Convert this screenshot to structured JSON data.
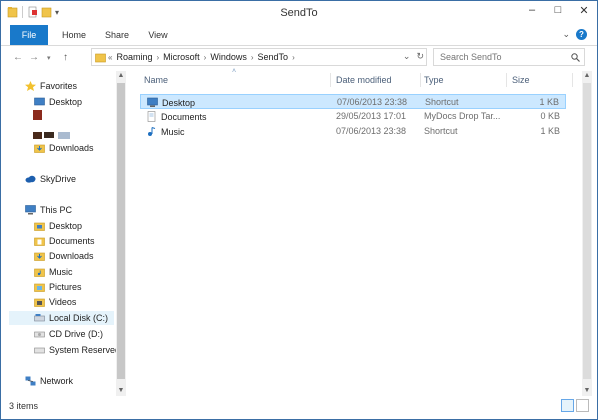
{
  "window": {
    "title": "SendTo"
  },
  "ribbon": {
    "tabs": [
      "File",
      "Home",
      "Share",
      "View"
    ],
    "expand_icon": "chevron-down-icon",
    "help_label": "?"
  },
  "address": {
    "breadcrumbs": [
      "Roaming",
      "Microsoft",
      "Windows",
      "SendTo"
    ],
    "prefix": "«"
  },
  "search": {
    "placeholder": "Search SendTo"
  },
  "nav": {
    "favorites_label": "Favorites",
    "desktop_label": "Desktop",
    "downloads_label": "Downloads",
    "skydrive_label": "SkyDrive",
    "thispc_label": "This PC",
    "pc_items": [
      "Desktop",
      "Documents",
      "Downloads",
      "Music",
      "Pictures",
      "Videos",
      "Local Disk (C:)",
      "CD Drive (D:)",
      "System Reserved"
    ],
    "network_label": "Network"
  },
  "columns": {
    "name": "Name",
    "date": "Date modified",
    "type": "Type",
    "size": "Size"
  },
  "files": [
    {
      "name": "Desktop",
      "date": "07/06/2013 23:38",
      "type": "Shortcut",
      "size": "1 KB"
    },
    {
      "name": "Documents",
      "date": "29/05/2013 17:01",
      "type": "MyDocs Drop Tar...",
      "size": "0 KB"
    },
    {
      "name": "Music",
      "date": "07/06/2013 23:38",
      "type": "Shortcut",
      "size": "1 KB"
    }
  ],
  "status": {
    "items_count": "3 items"
  },
  "colors": {
    "accent": "#1979ca",
    "selection": "#cce8ff",
    "header_text": "#4c607a"
  }
}
